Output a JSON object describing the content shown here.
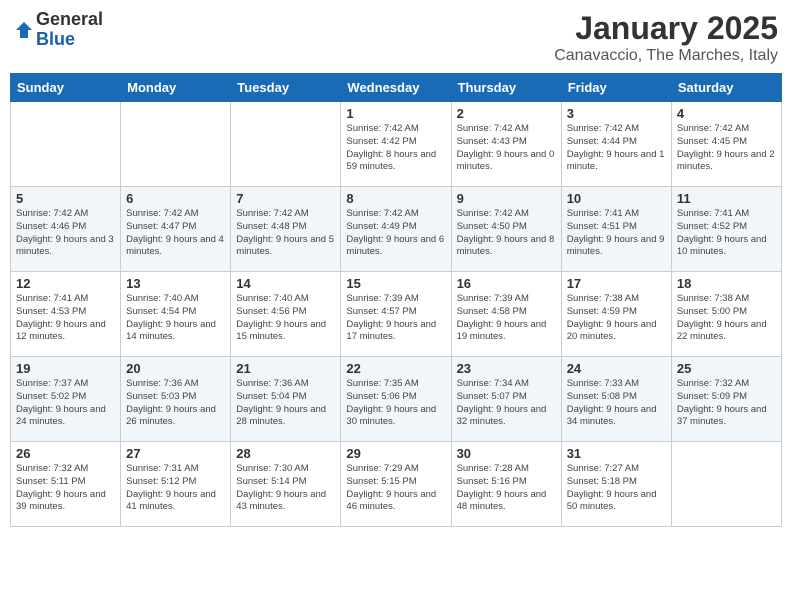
{
  "header": {
    "logo_general": "General",
    "logo_blue": "Blue",
    "month_title": "January 2025",
    "location": "Canavaccio, The Marches, Italy"
  },
  "weekdays": [
    "Sunday",
    "Monday",
    "Tuesday",
    "Wednesday",
    "Thursday",
    "Friday",
    "Saturday"
  ],
  "weeks": [
    [
      {
        "day": "",
        "info": ""
      },
      {
        "day": "",
        "info": ""
      },
      {
        "day": "",
        "info": ""
      },
      {
        "day": "1",
        "info": "Sunrise: 7:42 AM\nSunset: 4:42 PM\nDaylight: 8 hours and 59 minutes."
      },
      {
        "day": "2",
        "info": "Sunrise: 7:42 AM\nSunset: 4:43 PM\nDaylight: 9 hours and 0 minutes."
      },
      {
        "day": "3",
        "info": "Sunrise: 7:42 AM\nSunset: 4:44 PM\nDaylight: 9 hours and 1 minute."
      },
      {
        "day": "4",
        "info": "Sunrise: 7:42 AM\nSunset: 4:45 PM\nDaylight: 9 hours and 2 minutes."
      }
    ],
    [
      {
        "day": "5",
        "info": "Sunrise: 7:42 AM\nSunset: 4:46 PM\nDaylight: 9 hours and 3 minutes."
      },
      {
        "day": "6",
        "info": "Sunrise: 7:42 AM\nSunset: 4:47 PM\nDaylight: 9 hours and 4 minutes."
      },
      {
        "day": "7",
        "info": "Sunrise: 7:42 AM\nSunset: 4:48 PM\nDaylight: 9 hours and 5 minutes."
      },
      {
        "day": "8",
        "info": "Sunrise: 7:42 AM\nSunset: 4:49 PM\nDaylight: 9 hours and 6 minutes."
      },
      {
        "day": "9",
        "info": "Sunrise: 7:42 AM\nSunset: 4:50 PM\nDaylight: 9 hours and 8 minutes."
      },
      {
        "day": "10",
        "info": "Sunrise: 7:41 AM\nSunset: 4:51 PM\nDaylight: 9 hours and 9 minutes."
      },
      {
        "day": "11",
        "info": "Sunrise: 7:41 AM\nSunset: 4:52 PM\nDaylight: 9 hours and 10 minutes."
      }
    ],
    [
      {
        "day": "12",
        "info": "Sunrise: 7:41 AM\nSunset: 4:53 PM\nDaylight: 9 hours and 12 minutes."
      },
      {
        "day": "13",
        "info": "Sunrise: 7:40 AM\nSunset: 4:54 PM\nDaylight: 9 hours and 14 minutes."
      },
      {
        "day": "14",
        "info": "Sunrise: 7:40 AM\nSunset: 4:56 PM\nDaylight: 9 hours and 15 minutes."
      },
      {
        "day": "15",
        "info": "Sunrise: 7:39 AM\nSunset: 4:57 PM\nDaylight: 9 hours and 17 minutes."
      },
      {
        "day": "16",
        "info": "Sunrise: 7:39 AM\nSunset: 4:58 PM\nDaylight: 9 hours and 19 minutes."
      },
      {
        "day": "17",
        "info": "Sunrise: 7:38 AM\nSunset: 4:59 PM\nDaylight: 9 hours and 20 minutes."
      },
      {
        "day": "18",
        "info": "Sunrise: 7:38 AM\nSunset: 5:00 PM\nDaylight: 9 hours and 22 minutes."
      }
    ],
    [
      {
        "day": "19",
        "info": "Sunrise: 7:37 AM\nSunset: 5:02 PM\nDaylight: 9 hours and 24 minutes."
      },
      {
        "day": "20",
        "info": "Sunrise: 7:36 AM\nSunset: 5:03 PM\nDaylight: 9 hours and 26 minutes."
      },
      {
        "day": "21",
        "info": "Sunrise: 7:36 AM\nSunset: 5:04 PM\nDaylight: 9 hours and 28 minutes."
      },
      {
        "day": "22",
        "info": "Sunrise: 7:35 AM\nSunset: 5:06 PM\nDaylight: 9 hours and 30 minutes."
      },
      {
        "day": "23",
        "info": "Sunrise: 7:34 AM\nSunset: 5:07 PM\nDaylight: 9 hours and 32 minutes."
      },
      {
        "day": "24",
        "info": "Sunrise: 7:33 AM\nSunset: 5:08 PM\nDaylight: 9 hours and 34 minutes."
      },
      {
        "day": "25",
        "info": "Sunrise: 7:32 AM\nSunset: 5:09 PM\nDaylight: 9 hours and 37 minutes."
      }
    ],
    [
      {
        "day": "26",
        "info": "Sunrise: 7:32 AM\nSunset: 5:11 PM\nDaylight: 9 hours and 39 minutes."
      },
      {
        "day": "27",
        "info": "Sunrise: 7:31 AM\nSunset: 5:12 PM\nDaylight: 9 hours and 41 minutes."
      },
      {
        "day": "28",
        "info": "Sunrise: 7:30 AM\nSunset: 5:14 PM\nDaylight: 9 hours and 43 minutes."
      },
      {
        "day": "29",
        "info": "Sunrise: 7:29 AM\nSunset: 5:15 PM\nDaylight: 9 hours and 46 minutes."
      },
      {
        "day": "30",
        "info": "Sunrise: 7:28 AM\nSunset: 5:16 PM\nDaylight: 9 hours and 48 minutes."
      },
      {
        "day": "31",
        "info": "Sunrise: 7:27 AM\nSunset: 5:18 PM\nDaylight: 9 hours and 50 minutes."
      },
      {
        "day": "",
        "info": ""
      }
    ]
  ]
}
